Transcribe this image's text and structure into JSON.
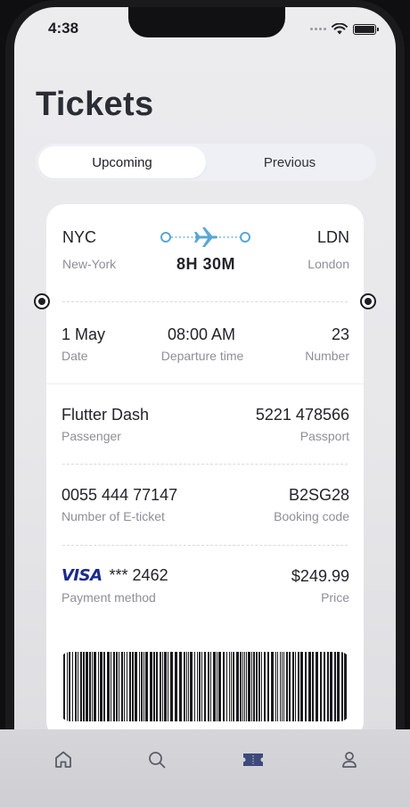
{
  "status_bar": {
    "time": "4:38"
  },
  "page": {
    "title": "Tickets"
  },
  "tabs": [
    {
      "label": "Upcoming",
      "active": true
    },
    {
      "label": "Previous",
      "active": false
    }
  ],
  "flight": {
    "origin_code": "NYC",
    "origin_name": "New-York",
    "destination_code": "LDN",
    "destination_name": "London",
    "duration": "8H 30M",
    "plane_icon": "airplane-icon"
  },
  "schedule": {
    "date_value": "1 May",
    "date_label": "Date",
    "departure_value": "08:00 AM",
    "departure_label": "Departure time",
    "number_value": "23",
    "number_label": "Number"
  },
  "passenger": {
    "name": "Flutter Dash",
    "name_label": "Passenger",
    "passport": "5221 478566",
    "passport_label": "Passport"
  },
  "booking": {
    "eticket": "0055 444 77147",
    "eticket_label": "Number of E-ticket",
    "code": "B2SG28",
    "code_label": "Booking code"
  },
  "payment": {
    "brand": "VISA",
    "card": "*** 2462",
    "method_label": "Payment method",
    "price": "$249.99",
    "price_label": "Price"
  },
  "nav": [
    {
      "icon": "home-icon"
    },
    {
      "icon": "search-icon"
    },
    {
      "icon": "ticket-icon",
      "active": true
    },
    {
      "icon": "profile-icon"
    }
  ],
  "colors": {
    "accent": "#3d4a7a",
    "route": "#5aa6d6",
    "text_primary": "#22242a",
    "text_secondary": "#8d8f98",
    "visa_blue": "#1a2a8c",
    "visa_gold": "#e8a21a"
  }
}
